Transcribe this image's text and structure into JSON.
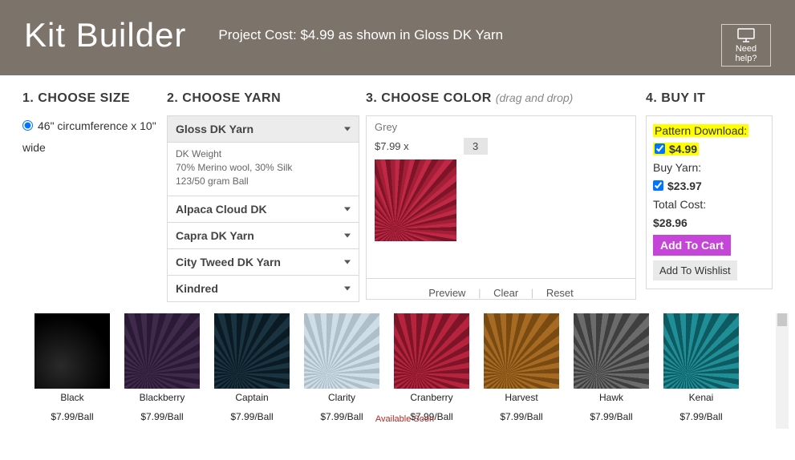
{
  "header": {
    "title": "Kit Builder",
    "cost_prefix": "Project Cost: ",
    "cost_value": "$4.99",
    "cost_suffix": " as shown in Gloss DK Yarn",
    "help_label": "Need help?"
  },
  "size": {
    "heading": "1. CHOOSE SIZE",
    "option": "46\" circumference x 10\" wide"
  },
  "yarn": {
    "heading": "2. CHOOSE YARN",
    "selected": "Gloss DK Yarn",
    "details_weight": "DK Weight",
    "details_fiber": "70% Merino wool, 30% Silk",
    "details_put_up": "123/50 gram Ball",
    "options": [
      "Alpaca Cloud DK",
      "Capra DK Yarn",
      "City Tweed DK Yarn",
      "Kindred"
    ]
  },
  "color": {
    "heading": "3. CHOOSE COLOR ",
    "heading_sub": "(drag and drop)",
    "name": "Grey",
    "price_label": "$7.99 x",
    "qty": "3",
    "actions": {
      "preview": "Preview",
      "clear": "Clear",
      "reset": "Reset"
    }
  },
  "buy": {
    "heading": "4. BUY IT",
    "pattern_label": "Pattern Download:",
    "pattern_price": "$4.99",
    "yarn_label": "Buy Yarn:",
    "yarn_price": "$23.97",
    "total_label": "Total Cost:",
    "total_price": "$28.96",
    "cart": "Add To Cart",
    "wishlist": "Add To Wishlist"
  },
  "palette": {
    "items": [
      {
        "name": "Black",
        "price": "$7.99/Ball",
        "cls": "sw-black"
      },
      {
        "name": "Blackberry",
        "price": "$7.99/Ball",
        "cls": "sw-blackberry"
      },
      {
        "name": "Captain",
        "price": "$7.99/Ball",
        "cls": "sw-captain"
      },
      {
        "name": "Clarity",
        "price": "$7.99/Ball",
        "cls": "sw-clarity"
      },
      {
        "name": "Cranberry",
        "price": "$7.99/Ball",
        "cls": "sw-cranberry"
      },
      {
        "name": "Harvest",
        "price": "$7.99/Ball",
        "cls": "sw-harvest"
      },
      {
        "name": "Hawk",
        "price": "$7.99/Ball",
        "cls": "sw-hawk"
      },
      {
        "name": "Kenai",
        "price": "$7.99/Ball",
        "cls": "sw-kenai"
      }
    ],
    "available_soon": "Available Soon"
  }
}
